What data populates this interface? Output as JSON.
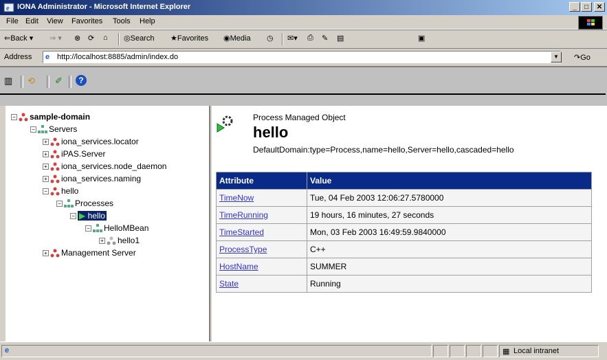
{
  "window": {
    "title": "IONA Administrator - Microsoft Internet Explorer",
    "minimize": "_",
    "maximize": "□",
    "close": "✕"
  },
  "menu": [
    "File",
    "Edit",
    "View",
    "Favorites",
    "Tools",
    "Help"
  ],
  "toolbar": {
    "back": "Back",
    "search": "Search",
    "favorites": "Favorites",
    "media": "Media"
  },
  "address": {
    "label": "Address",
    "url": "http://localhost:8885/admin/index.do",
    "go": "Go"
  },
  "tree": {
    "domain": "sample-domain",
    "servers": "Servers",
    "items": [
      "iona_services.locator",
      "iPAS.Server",
      "iona_services.node_daemon",
      "iona_services.naming"
    ],
    "hello": "hello",
    "processes": "Processes",
    "process_hello": "hello",
    "mbean": "HelloMBean",
    "hello1": "hello1",
    "management": "Management Server"
  },
  "detail": {
    "subtitle": "Process Managed Object",
    "title": "hello",
    "object_name": "DefaultDomain:type=Process,name=hello,Server=hello,cascaded=hello",
    "columns": [
      "Attribute",
      "Value"
    ],
    "rows": [
      {
        "attribute": "TimeNow",
        "value": "Tue, 04 Feb 2003 12:06:27.5780000"
      },
      {
        "attribute": "TimeRunning",
        "value": "19 hours, 16 minutes, 27 seconds"
      },
      {
        "attribute": "TimeStarted",
        "value": "Mon, 03 Feb 2003 16:49:59.9840000"
      },
      {
        "attribute": "ProcessType",
        "value": "C++"
      },
      {
        "attribute": "HostName",
        "value": "SUMMER"
      },
      {
        "attribute": "State",
        "value": "Running"
      }
    ]
  },
  "status": {
    "zone": "Local intranet"
  }
}
